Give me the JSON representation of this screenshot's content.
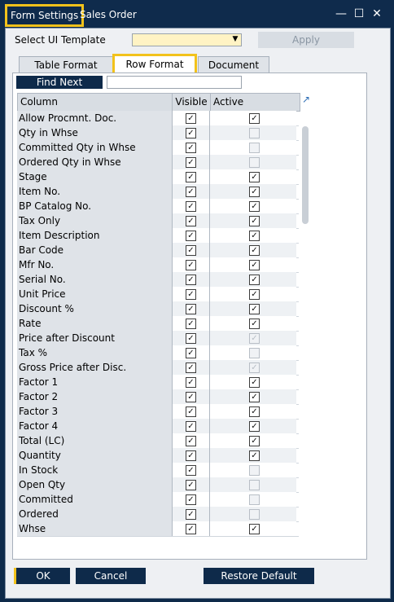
{
  "titlebar": {
    "tab1": "Form Settings",
    "tab2": "Sales Order",
    "minimize": "—",
    "maximize": "☐",
    "close": "✕"
  },
  "template": {
    "label": "Select UI Template",
    "value": "",
    "apply": "Apply"
  },
  "tabs": [
    "Table Format",
    "Row Format",
    "Document"
  ],
  "find": {
    "button": "Find Next",
    "value": ""
  },
  "grid": {
    "headers": [
      "Column",
      "Visible",
      "Active"
    ],
    "rows": [
      {
        "name": "Allow Procmnt. Doc.",
        "visible": true,
        "active": true,
        "active_disabled": false
      },
      {
        "name": "Qty in Whse",
        "visible": true,
        "active": false,
        "active_disabled": true
      },
      {
        "name": "Committed Qty in Whse",
        "visible": true,
        "active": false,
        "active_disabled": true
      },
      {
        "name": "Ordered Qty in Whse",
        "visible": true,
        "active": false,
        "active_disabled": true
      },
      {
        "name": "Stage",
        "visible": true,
        "active": true,
        "active_disabled": false
      },
      {
        "name": "Item No.",
        "visible": true,
        "active": true,
        "active_disabled": false
      },
      {
        "name": "BP Catalog No.",
        "visible": true,
        "active": true,
        "active_disabled": false
      },
      {
        "name": "Tax Only",
        "visible": true,
        "active": true,
        "active_disabled": false
      },
      {
        "name": "Item Description",
        "visible": true,
        "active": true,
        "active_disabled": false
      },
      {
        "name": "Bar Code",
        "visible": true,
        "active": true,
        "active_disabled": false
      },
      {
        "name": "Mfr No.",
        "visible": true,
        "active": true,
        "active_disabled": false
      },
      {
        "name": "Serial No.",
        "visible": true,
        "active": true,
        "active_disabled": false
      },
      {
        "name": "Unit Price",
        "visible": true,
        "active": true,
        "active_disabled": false
      },
      {
        "name": "Discount %",
        "visible": true,
        "active": true,
        "active_disabled": false
      },
      {
        "name": "Rate",
        "visible": true,
        "active": true,
        "active_disabled": false
      },
      {
        "name": "Price after Discount",
        "visible": true,
        "active": true,
        "active_disabled": true
      },
      {
        "name": "Tax %",
        "visible": true,
        "active": false,
        "active_disabled": true
      },
      {
        "name": "Gross Price after Disc.",
        "visible": true,
        "active": true,
        "active_disabled": true
      },
      {
        "name": "Factor 1",
        "visible": true,
        "active": true,
        "active_disabled": false
      },
      {
        "name": "Factor 2",
        "visible": true,
        "active": true,
        "active_disabled": false
      },
      {
        "name": "Factor 3",
        "visible": true,
        "active": true,
        "active_disabled": false
      },
      {
        "name": "Factor 4",
        "visible": true,
        "active": true,
        "active_disabled": false
      },
      {
        "name": "Total (LC)",
        "visible": true,
        "active": true,
        "active_disabled": false
      },
      {
        "name": "Quantity",
        "visible": true,
        "active": true,
        "active_disabled": false
      },
      {
        "name": "In Stock",
        "visible": true,
        "active": false,
        "active_disabled": true
      },
      {
        "name": "Open Qty",
        "visible": true,
        "active": false,
        "active_disabled": true
      },
      {
        "name": "Committed",
        "visible": true,
        "active": false,
        "active_disabled": true
      },
      {
        "name": "Ordered",
        "visible": true,
        "active": false,
        "active_disabled": true
      },
      {
        "name": "Whse",
        "visible": true,
        "active": true,
        "active_disabled": false
      }
    ]
  },
  "buttons": {
    "ok": "OK",
    "cancel": "Cancel",
    "restore": "Restore Default"
  },
  "colors": {
    "accent": "#f2c21b",
    "navy": "#0e2a4a"
  }
}
